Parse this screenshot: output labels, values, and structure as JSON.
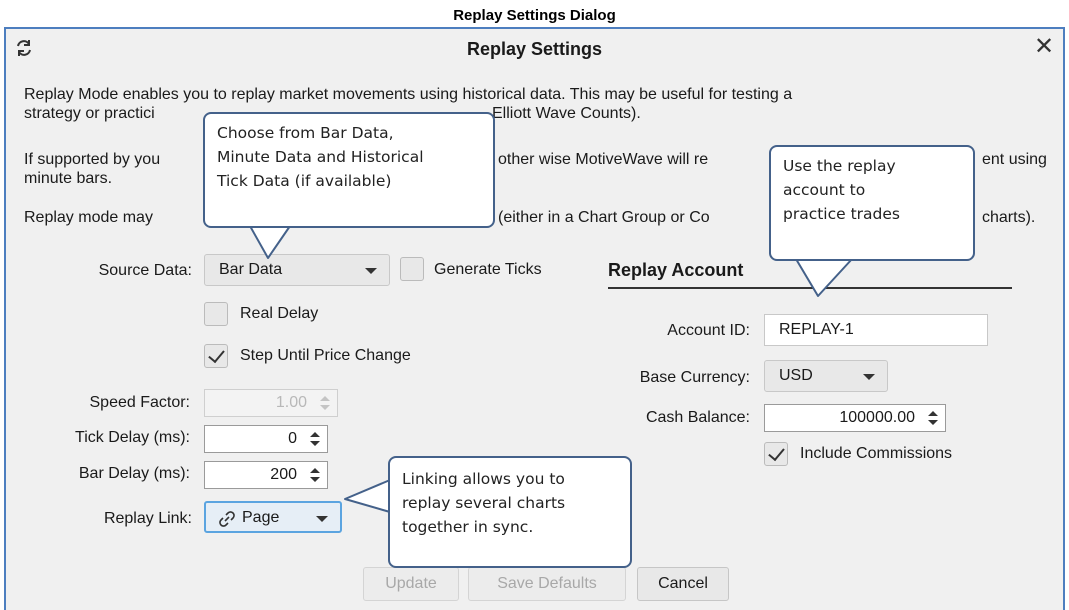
{
  "document": {
    "caption": "Replay Settings Dialog"
  },
  "window": {
    "title": "Replay Settings",
    "close_glyph": "✕",
    "app_icon": "replay-icon"
  },
  "description": {
    "para1_line1": "Replay Mode enables you to replay market movements using historical data.  This may be useful for testing a",
    "para1_line2": "strategy or practici",
    "para1_line2b": "Elliott Wave Counts).",
    "para2_line1a": "If supported by you",
    "para2_line1b": "other wise MotiveWave will re",
    "para2_line1c": "ent using",
    "para2_line2": "minute bars.",
    "para3_a": "Replay mode may",
    "para3_b": "(either in a Chart Group or Co",
    "para3_c": "charts)."
  },
  "settings": {
    "source_data_label": "Source Data:",
    "source_data_value": "Bar Data",
    "generate_ticks_label": "Generate Ticks",
    "generate_ticks_checked": false,
    "real_delay_label": "Real Delay",
    "real_delay_checked": false,
    "step_until_label": "Step Until Price Change",
    "step_until_checked": true,
    "speed_factor_label": "Speed Factor:",
    "speed_factor_value": "1.00",
    "tick_delay_label": "Tick Delay (ms):",
    "tick_delay_value": "0",
    "bar_delay_label": "Bar Delay (ms):",
    "bar_delay_value": "200",
    "replay_link_label": "Replay Link:",
    "replay_link_value": "Page"
  },
  "account": {
    "section_title": "Replay Account",
    "account_id_label": "Account ID:",
    "account_id_value": "REPLAY-1",
    "base_currency_label": "Base Currency:",
    "base_currency_value": "USD",
    "cash_balance_label": "Cash Balance:",
    "cash_balance_value": "100000.00",
    "include_commissions_label": "Include Commissions",
    "include_commissions_checked": true
  },
  "buttons": {
    "update": "Update",
    "save_defaults": "Save Defaults",
    "cancel": "Cancel"
  },
  "callouts": {
    "source_line1": "Choose from Bar Data,",
    "source_line2": "Minute Data and Historical",
    "source_line3": "Tick Data (if available)",
    "account_line1": "Use the replay",
    "account_line2": "account to",
    "account_line3": "practice trades",
    "link_line1": "Linking allows you to",
    "link_line2": "replay several charts",
    "link_line3": "together in sync."
  },
  "colors": {
    "window_border": "#4d7ebf",
    "callout_border": "#44618a",
    "link_focus": "#5ba4e0"
  }
}
